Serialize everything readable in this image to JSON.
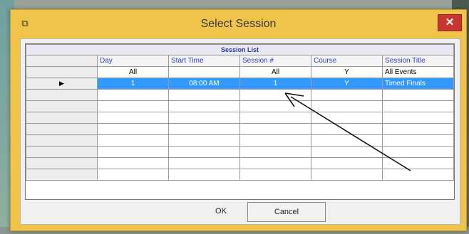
{
  "window": {
    "title": "Select Session",
    "close_symbol": "✕"
  },
  "grid": {
    "caption": "Session List",
    "columns": [
      "Day",
      "Start Time",
      "Session #",
      "Course",
      "Session Title"
    ],
    "rows": [
      {
        "day": "All",
        "start": "",
        "session": "All",
        "course": "Y",
        "title": "All Events",
        "selected": false
      },
      {
        "day": "1",
        "start": "08:00 AM",
        "session": "1",
        "course": "Y",
        "title": "Timed Finals",
        "selected": true
      }
    ],
    "selected_row_marker": "▶",
    "empty_row_count": 8
  },
  "buttons": {
    "ok_label": "OK",
    "cancel_label": "Cancel"
  },
  "colors": {
    "selection": "#3399ff",
    "title_bar": "#f0c44a",
    "close_button": "#c7372f"
  }
}
